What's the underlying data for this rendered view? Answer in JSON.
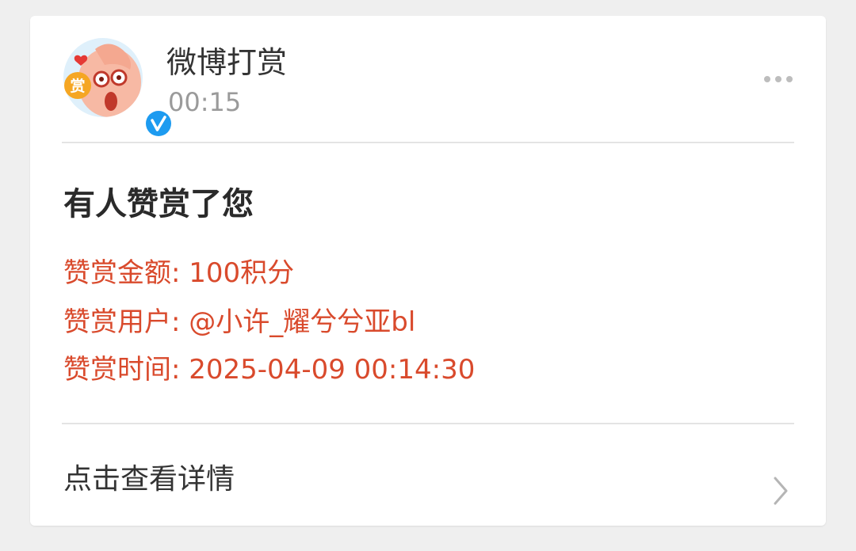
{
  "sender": {
    "name": "微博打赏",
    "time": "00:15",
    "avatar_badge": "赏"
  },
  "notification": {
    "title": "有人赞赏了您",
    "amount_line": "赞赏金额: 100积分",
    "user_line": "赞赏用户: @小许_耀兮兮亚bl",
    "time_line": "赞赏时间: 2025-04-09 00:14:30"
  },
  "footer": {
    "link_label": "点击查看详情"
  },
  "icons": {
    "more": "more-dots-icon",
    "chevron": "chevron-right-icon",
    "verified": "verified-badge-icon"
  },
  "colors": {
    "accent_red": "#d94a2c",
    "verified_blue": "#1d9bf0",
    "background": "#efefef"
  }
}
